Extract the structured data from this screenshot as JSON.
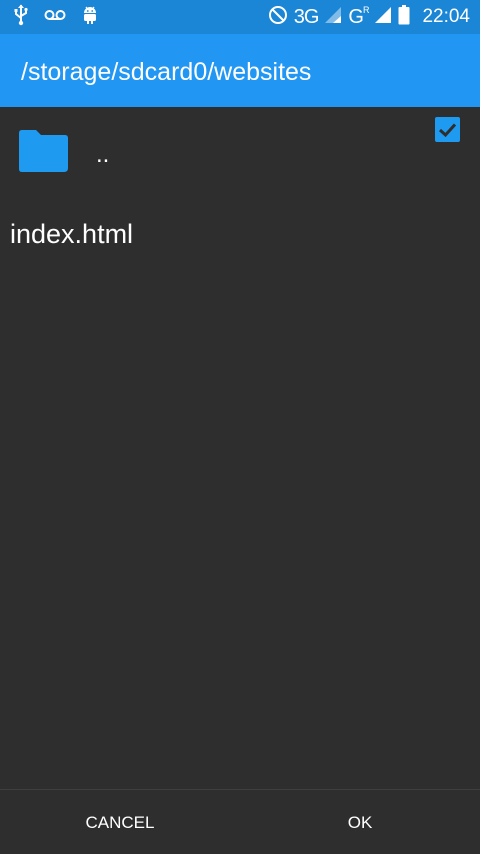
{
  "status_bar": {
    "left_icons": [
      "usb-icon",
      "voicemail-icon",
      "android-debug-icon"
    ],
    "right_icons": [
      "do-not-disturb-icon",
      "signal-3g-icon",
      "signal-roaming-icon",
      "battery-icon"
    ],
    "network_1": "3G",
    "network_2": "G",
    "roaming_mark": "R",
    "time": "22:04"
  },
  "header": {
    "path": "/storage/sdcard0/websites"
  },
  "list": {
    "parent_label": "..",
    "items": [
      {
        "name": "index.html",
        "checked": true
      }
    ]
  },
  "footer": {
    "cancel_label": "CANCEL",
    "ok_label": "OK"
  },
  "colors": {
    "status_bar": "#1b86d6",
    "app_bar": "#2196f3",
    "background": "#2e2e2e",
    "folder": "#1e9bf0",
    "checkbox": "#1e9bf0"
  }
}
